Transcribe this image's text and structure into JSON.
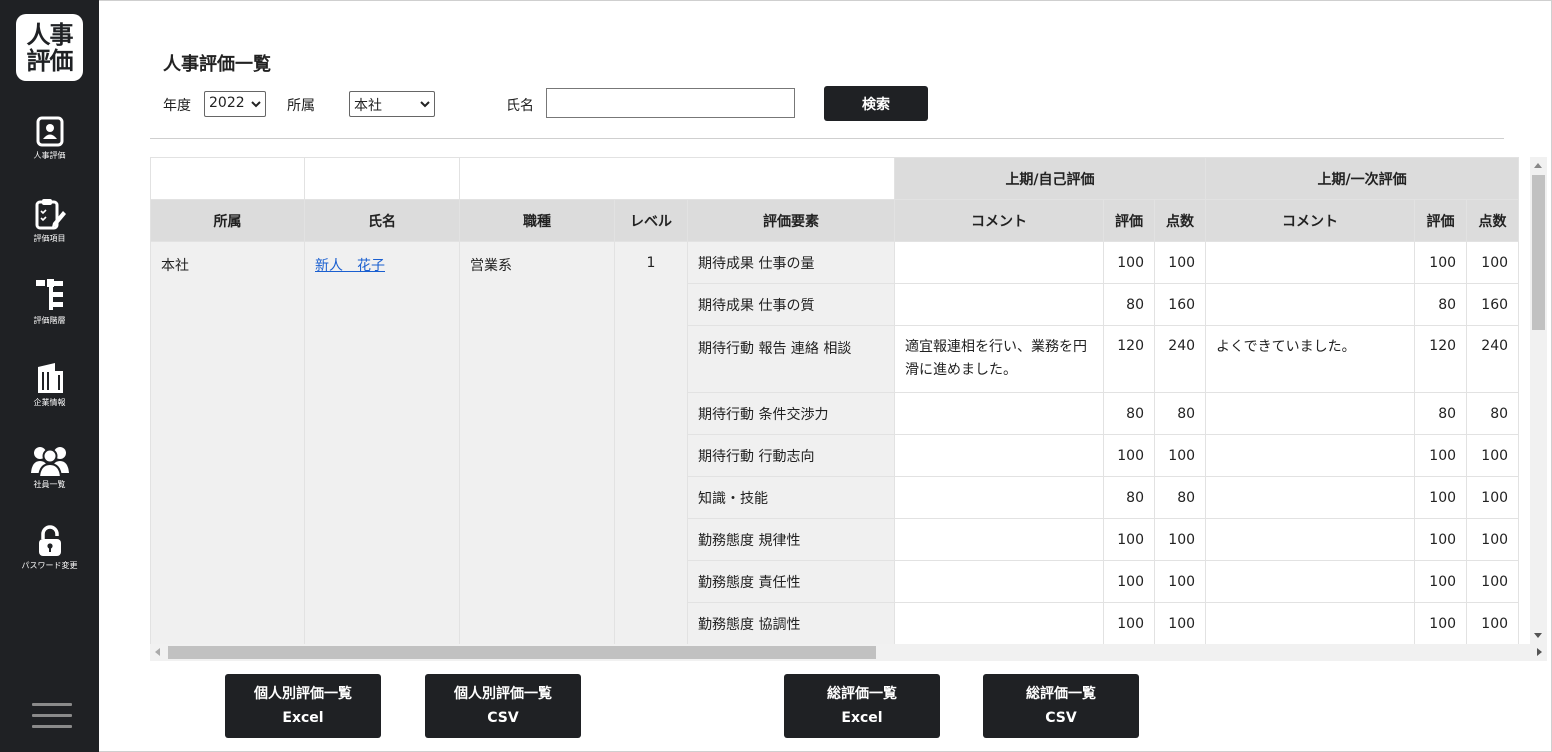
{
  "app": {
    "logo_line1": "人事",
    "logo_line2": "評価"
  },
  "sidebar": {
    "items": [
      {
        "label": "人事評価",
        "icon": "person-id-icon"
      },
      {
        "label": "評価項目",
        "icon": "clipboard-edit-icon"
      },
      {
        "label": "評価階層",
        "icon": "hierarchy-icon"
      },
      {
        "label": "企業情報",
        "icon": "building-icon"
      },
      {
        "label": "社員一覧",
        "icon": "people-icon"
      },
      {
        "label": "パスワード変更",
        "icon": "lock-icon"
      }
    ],
    "menu_icon": "hamburger-icon"
  },
  "page": {
    "title": "人事評価一覧"
  },
  "filters": {
    "year_label": "年度",
    "year_value": "2022",
    "dept_label": "所属",
    "dept_value": "本社",
    "name_label": "氏名",
    "name_value": "",
    "search_label": "検索"
  },
  "table": {
    "group_headers": {
      "self": "上期/自己評価",
      "first": "上期/一次評価"
    },
    "columns": {
      "dept": "所属",
      "name": "氏名",
      "job": "職種",
      "level": "レベル",
      "element": "評価要素",
      "comment": "コメント",
      "rating": "評価",
      "score": "点数"
    },
    "employee": {
      "dept": "本社",
      "name": "新人　花子",
      "job": "営業系",
      "level": "1"
    },
    "rows": [
      {
        "element": "期待成果 仕事の量",
        "self_comment": "",
        "self_rating": "100",
        "self_score": "100",
        "first_comment": "",
        "first_rating": "100",
        "first_score": "100"
      },
      {
        "element": "期待成果 仕事の質",
        "self_comment": "",
        "self_rating": "80",
        "self_score": "160",
        "first_comment": "",
        "first_rating": "80",
        "first_score": "160"
      },
      {
        "element": "期待行動 報告 連絡 相談",
        "self_comment": "適宜報連相を行い、業務を円滑に進めました。",
        "self_rating": "120",
        "self_score": "240",
        "first_comment": "よくできていました。",
        "first_rating": "120",
        "first_score": "240"
      },
      {
        "element": "期待行動 条件交渉力",
        "self_comment": "",
        "self_rating": "80",
        "self_score": "80",
        "first_comment": "",
        "first_rating": "80",
        "first_score": "80"
      },
      {
        "element": "期待行動 行動志向",
        "self_comment": "",
        "self_rating": "100",
        "self_score": "100",
        "first_comment": "",
        "first_rating": "100",
        "first_score": "100"
      },
      {
        "element": "知識・技能",
        "self_comment": "",
        "self_rating": "80",
        "self_score": "80",
        "first_comment": "",
        "first_rating": "100",
        "first_score": "100"
      },
      {
        "element": "勤務態度 規律性",
        "self_comment": "",
        "self_rating": "100",
        "self_score": "100",
        "first_comment": "",
        "first_rating": "100",
        "first_score": "100"
      },
      {
        "element": "勤務態度 責任性",
        "self_comment": "",
        "self_rating": "100",
        "self_score": "100",
        "first_comment": "",
        "first_rating": "100",
        "first_score": "100"
      },
      {
        "element": "勤務態度 協調性",
        "self_comment": "",
        "self_rating": "100",
        "self_score": "100",
        "first_comment": "",
        "first_rating": "100",
        "first_score": "100"
      }
    ]
  },
  "exports": {
    "individual_excel": {
      "line1": "個人別評価一覧",
      "line2": "Excel"
    },
    "individual_csv": {
      "line1": "個人別評価一覧",
      "line2": "CSV"
    },
    "total_excel": {
      "line1": "総評価一覧",
      "line2": "Excel"
    },
    "total_csv": {
      "line1": "総評価一覧",
      "line2": "CSV"
    }
  },
  "colors": {
    "sidebar": "#1f2124",
    "header_bg": "#dcdcdc",
    "link": "#1a5fd0"
  }
}
